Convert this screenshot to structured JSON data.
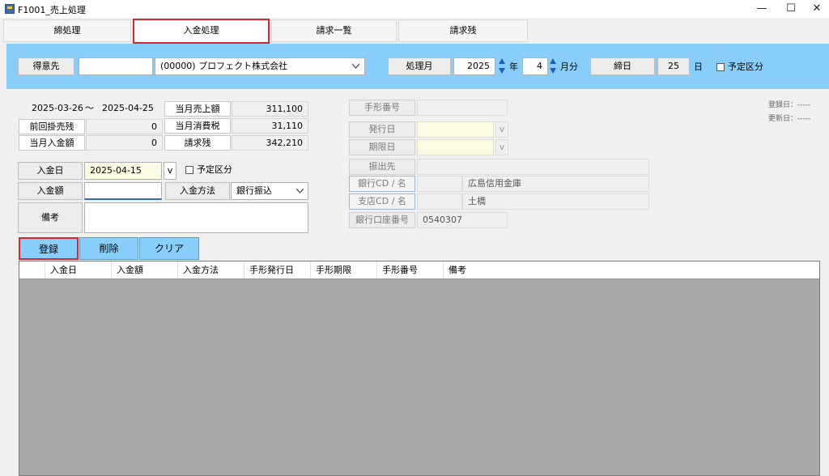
{
  "window": {
    "title": "F1001_売上処理",
    "minimize": "—",
    "maximize": "☐",
    "close": "✕"
  },
  "tabs": [
    {
      "label": "締処理"
    },
    {
      "label": "入金処理"
    },
    {
      "label": "請求一覧"
    },
    {
      "label": "請求残"
    }
  ],
  "header": {
    "customer_label": "得意先",
    "customer_code": "",
    "customer_name": "(00000) プロフェクト株式会社",
    "month_label": "処理月",
    "year": "2025",
    "year_unit": "年",
    "month": "4",
    "month_unit": "月分",
    "closing_label": "締日",
    "closing_day": "25",
    "day_unit": "日",
    "scheduled_label": "予定区分"
  },
  "period": {
    "from": "2025-03-26",
    "tilde": "～",
    "to": "2025-04-25"
  },
  "summary": {
    "prev_balance_label": "前回掛売残",
    "prev_balance": "0",
    "payment_label": "当月入金額",
    "payment": "0",
    "sales_label": "当月売上額",
    "sales": "311,100",
    "tax_label": "当月消費税",
    "tax": "31,110",
    "billing_label": "請求残",
    "billing": "342,210"
  },
  "form": {
    "date_label": "入金日",
    "date": "2025-04-15",
    "date_dropdown": "v",
    "scheduled_label": "予定区分",
    "amount_label": "入金額",
    "amount": "",
    "method_label": "入金方法",
    "method": "銀行振込",
    "note_label": "備考",
    "note": ""
  },
  "bill": {
    "number_label": "手形番号",
    "issue_label": "発行日",
    "due_label": "期限日",
    "drawer_label": "振出先",
    "bank_label": "銀行CD / 名",
    "bank_code": "",
    "bank_name": "広島信用金庫",
    "branch_label": "支店CD / 名",
    "branch_code": "",
    "branch_name": "土橋",
    "account_label": "銀行口座番号",
    "account": "0540307",
    "dropdown": "v"
  },
  "meta": {
    "registered": "登録日：-----",
    "updated": "更新日：-----"
  },
  "buttons": {
    "register": "登録",
    "delete": "削除",
    "clear": "クリア"
  },
  "grid": {
    "columns": [
      "入金日",
      "入金額",
      "入金方法",
      "手形発行日",
      "手形期限",
      "手形番号",
      "備考"
    ]
  },
  "colors": {
    "accent": "#87cefa",
    "highlight": "#d9262b"
  }
}
